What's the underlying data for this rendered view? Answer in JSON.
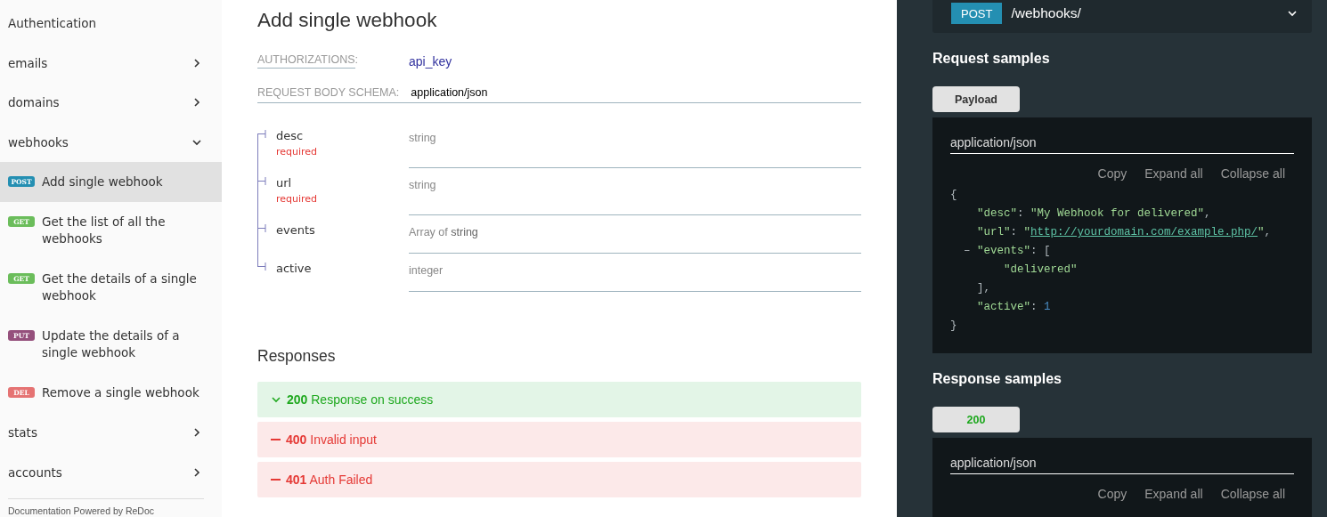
{
  "sidebar": {
    "items": [
      {
        "kind": "page",
        "label": "Authentication"
      },
      {
        "kind": "group",
        "label": "emails",
        "expanded": false
      },
      {
        "kind": "group",
        "label": "domains",
        "expanded": false
      },
      {
        "kind": "group",
        "label": "webhooks",
        "expanded": true,
        "children": [
          {
            "method": "POST",
            "label": "Add single webhook",
            "selected": true
          },
          {
            "method": "GET",
            "label": "Get the list of all the webhooks",
            "selected": false
          },
          {
            "method": "GET",
            "label": "Get the details of a single webhook",
            "selected": false
          },
          {
            "method": "PUT",
            "label": "Update the details of a single webhook",
            "selected": false
          },
          {
            "method": "DEL",
            "label": "Remove a single webhook",
            "selected": false
          }
        ]
      },
      {
        "kind": "group",
        "label": "stats",
        "expanded": false
      },
      {
        "kind": "group",
        "label": "accounts",
        "expanded": false
      }
    ],
    "footer": "Documentation Powered by ReDoc"
  },
  "operation": {
    "title": "Add single webhook",
    "authorizations_label": "AUTHORIZATIONS:",
    "authorizations_value": "api_key",
    "schema_label": "REQUEST BODY SCHEMA:",
    "schema_value": "application/json",
    "fields": [
      {
        "name": "desc",
        "required_label": "required",
        "type": "string"
      },
      {
        "name": "url",
        "required_label": "required",
        "type": "string"
      },
      {
        "name": "events",
        "type_prefix": "Array of ",
        "type": "string"
      },
      {
        "name": "active",
        "type": "integer"
      }
    ],
    "responses_title": "Responses",
    "responses": [
      {
        "kind": "success",
        "expanded": true,
        "code": "200",
        "description": "Response on success"
      },
      {
        "kind": "error",
        "expanded": false,
        "code": "400",
        "description": "Invalid input"
      },
      {
        "kind": "error",
        "expanded": false,
        "code": "401",
        "description": "Auth Failed"
      }
    ]
  },
  "samples": {
    "endpoint": {
      "method": "POST",
      "path": "/webhooks/"
    },
    "request": {
      "title": "Request samples",
      "tabs": [
        {
          "label": "Payload",
          "kind": "neutral",
          "selected": true
        }
      ],
      "content_type": "application/json",
      "actions": [
        "Copy",
        "Expand all",
        "Collapse all"
      ],
      "code": [
        [
          {
            "kind": "punct",
            "text": "{"
          }
        ],
        [
          {
            "kind": "key",
            "text": "    \"desc\""
          },
          {
            "kind": "punct",
            "text": ": "
          },
          {
            "kind": "string",
            "text": "\"My Webhook for delivered\""
          },
          {
            "kind": "punct",
            "text": ","
          }
        ],
        [
          {
            "kind": "key",
            "text": "    \"url\""
          },
          {
            "kind": "punct",
            "text": ": "
          },
          {
            "kind": "string",
            "text": "\""
          },
          {
            "kind": "link",
            "text": "http://yourdomain.com/example.php/"
          },
          {
            "kind": "string",
            "text": "\""
          },
          {
            "kind": "punct",
            "text": ","
          }
        ],
        [
          {
            "kind": "punct",
            "text": "  – "
          },
          {
            "kind": "key",
            "text": "\"events\""
          },
          {
            "kind": "punct",
            "text": ": ["
          }
        ],
        [
          {
            "kind": "string",
            "text": "        \"delivered\""
          }
        ],
        [
          {
            "kind": "punct",
            "text": "    ],"
          }
        ],
        [
          {
            "kind": "key",
            "text": "    \"active\""
          },
          {
            "kind": "punct",
            "text": ": "
          },
          {
            "kind": "number",
            "text": "1"
          }
        ],
        [
          {
            "kind": "punct",
            "text": "}"
          }
        ]
      ]
    },
    "response": {
      "title": "Response samples",
      "tabs": [
        {
          "label": "200",
          "kind": "success",
          "selected": true
        }
      ],
      "content_type": "application/json",
      "actions": [
        "Copy",
        "Expand all",
        "Collapse all"
      ]
    }
  }
}
